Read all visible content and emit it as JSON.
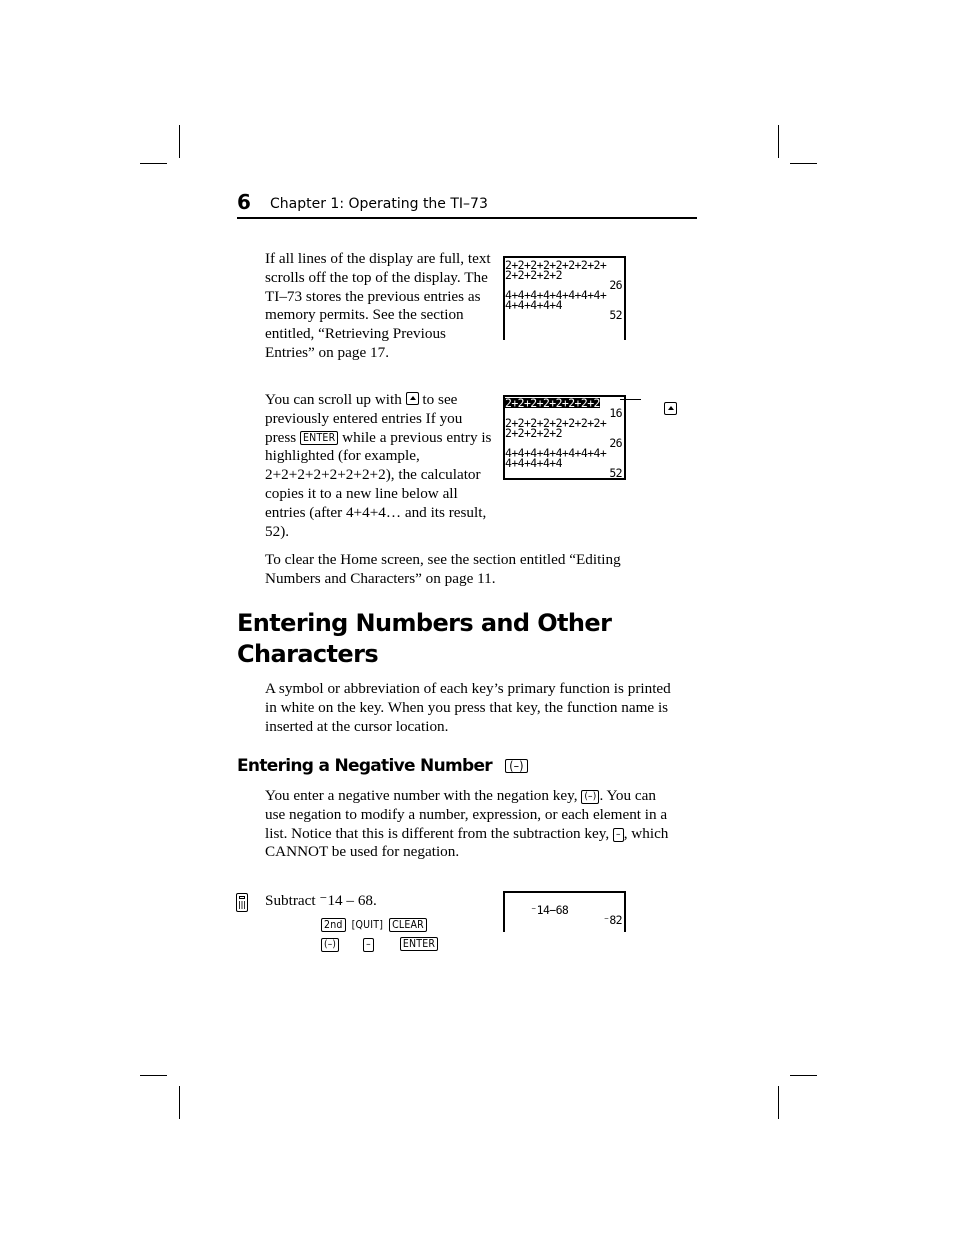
{
  "header": {
    "page_number": "6",
    "chapter_title": "Chapter 1: Operating the TI–73"
  },
  "section_scroll": {
    "paragraph1": "If all lines of the display are full, text scrolls off the top of the display. The TI–73 stores the previous entries as memory permits. See the section entitled, “Retrieving Previous Entries” on page 17.",
    "paragraph2": {
      "part1": "You can scroll up with ",
      "key_up_arrow": "up-arrow",
      "part2": " to see previously entered entries  If you press ",
      "key_enter": "ENTER",
      "part3": " while a previous entry is highlighted (for example, 2+2+2+2+2+2+2+2), the calculator copies it to a new line below all entries (after 4+4+4… and its result, 52)."
    },
    "paragraph3": "To clear the Home screen, see the section entitled “Editing Numbers and Characters” on page 11.",
    "screen1": {
      "lines": [
        {
          "text": "2+2+2+2+2+2+2+2+",
          "align": "left"
        },
        {
          "text": "2+2+2+2+2",
          "align": "left"
        },
        {
          "text": "26",
          "align": "right"
        },
        {
          "text": "4+4+4+4+4+4+4+4+",
          "align": "left"
        },
        {
          "text": "4+4+4+4+4",
          "align": "left"
        },
        {
          "text": "52",
          "align": "right"
        },
        {
          "text": "",
          "align": "left"
        }
      ]
    },
    "screen2": {
      "highlighted_line": "2+2+2+2+2+2+2+2",
      "lines": [
        {
          "text": "16",
          "align": "right"
        },
        {
          "text": "2+2+2+2+2+2+2+2+",
          "align": "left"
        },
        {
          "text": "2+2+2+2+2",
          "align": "left"
        },
        {
          "text": "26",
          "align": "right"
        },
        {
          "text": "4+4+4+4+4+4+4+4+",
          "align": "left"
        },
        {
          "text": "4+4+4+4+4",
          "align": "left"
        },
        {
          "text": "52",
          "align": "right"
        }
      ],
      "callout_key": "up-arrow"
    }
  },
  "section_entering": {
    "title_line1": "Entering Numbers and Other",
    "title_line2": "Characters",
    "paragraph": "A symbol or abbreviation of each key’s primary function is printed in white on the key. When you press that key, the function name is inserted at the cursor location."
  },
  "section_negative": {
    "title": "Entering a Negative Number",
    "title_key": "(–)",
    "paragraph": {
      "part1": "You enter a negative number with the negation key, ",
      "key_neg": "(–)",
      "part2": ". You can use negation to modify a number, expression, or each element in a list. Notice that this is different from the subtraction key, ",
      "key_sub": "–",
      "part3": ", which CANNOT be used for negation."
    },
    "example": {
      "icon": "calculator-icon",
      "text_prefix": "Subtract ",
      "text_value": "⁻14 – 68.",
      "keys_row1": [
        "2nd",
        "[QUIT]",
        "CLEAR"
      ],
      "keys_row2": [
        "(–)",
        "–",
        "ENTER"
      ],
      "screen": {
        "expression": "⁻14−68",
        "result": "⁻82"
      }
    }
  }
}
